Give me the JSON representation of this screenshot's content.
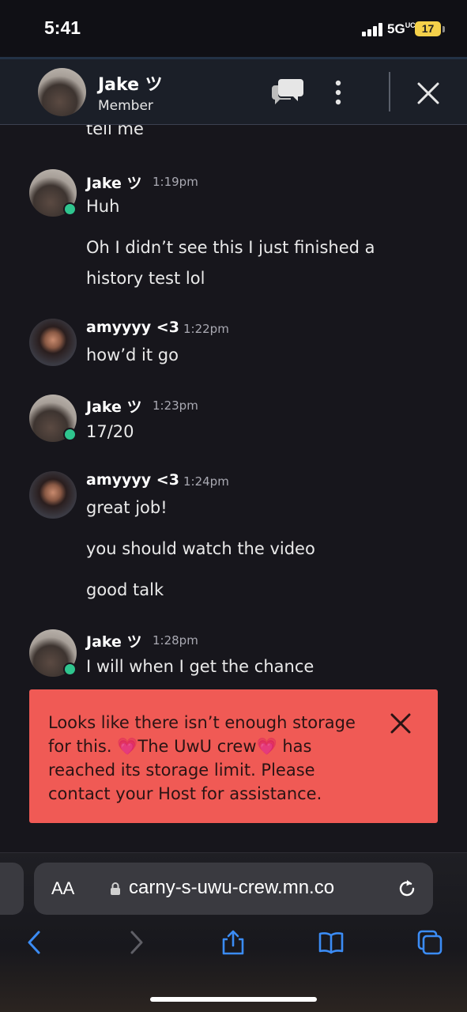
{
  "status_bar": {
    "time": "5:41",
    "network": "5G",
    "network_sub": "UC",
    "battery": "17"
  },
  "header": {
    "name": "Jake ツ",
    "role": "Member"
  },
  "messages": [
    {
      "tail_text": "tell me"
    },
    {
      "sender": "Jake ツ",
      "time": "1:19pm",
      "lines": [
        "Huh",
        "Oh I didn’t see this I just finished a",
        "history test lol"
      ]
    },
    {
      "sender": "amyyyy <3",
      "time": "1:22pm",
      "lines": [
        "how’d it go"
      ]
    },
    {
      "sender": "Jake ツ",
      "time": "1:23pm",
      "lines": [
        "17/20"
      ]
    },
    {
      "sender": "amyyyy <3",
      "time": "1:24pm",
      "lines": [
        "great job!",
        "you should watch the video",
        "good talk"
      ]
    },
    {
      "sender": "Jake ツ",
      "time": "1:28pm",
      "lines": [
        "I will when I get the chance"
      ]
    }
  ],
  "toast": {
    "line1": "Looks like there isn’t enough storage",
    "line2": "for this. 💗The UwU crew💗 has",
    "line3": "reached its storage limit. Please",
    "line4": "contact your Host for assistance."
  },
  "browser": {
    "aa_label": "AA",
    "url": "carny-s-uwu-crew.mn.co"
  },
  "colors": {
    "online": "#2fc58e",
    "toast_bg": "#f05a55",
    "ios_blue": "#3b8cf5"
  }
}
